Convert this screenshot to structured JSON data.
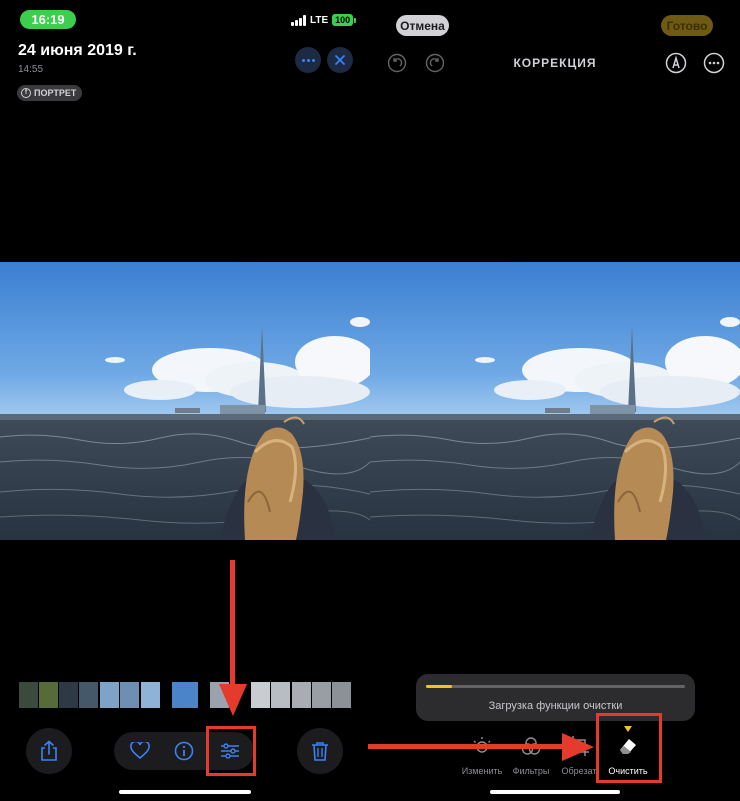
{
  "left": {
    "status": {
      "time": "16:19",
      "network": "LTE",
      "battery": "100"
    },
    "header": {
      "date": "24 июня 2019 г.",
      "time": "14:55",
      "badge": "ПОРТРЕТ"
    },
    "actions": [
      "more-icon",
      "close-icon"
    ],
    "bottom_toolbar": [
      "share-icon",
      "heart-icon",
      "info-icon",
      "adjust-sliders-icon",
      "trash-icon"
    ]
  },
  "right": {
    "header": {
      "cancel": "Отмена",
      "done": "Готово",
      "title": "КОРРЕКЦИЯ"
    },
    "loading": {
      "text": "Загрузка функции очистки",
      "progress": 0.1
    },
    "tools": [
      {
        "label": "Изменить",
        "icon": "adjust-icon"
      },
      {
        "label": "Фильтры",
        "icon": "filters-icon"
      },
      {
        "label": "Обрезат",
        "icon": "crop-icon"
      },
      {
        "label": "Очистить",
        "icon": "eraser-icon",
        "active": true
      }
    ]
  },
  "colors": {
    "accent_blue": "#3b82f6",
    "annotation_red": "#e53b2c",
    "status_green": "#3ccf4e",
    "progress_yellow": "#f2c12e"
  }
}
